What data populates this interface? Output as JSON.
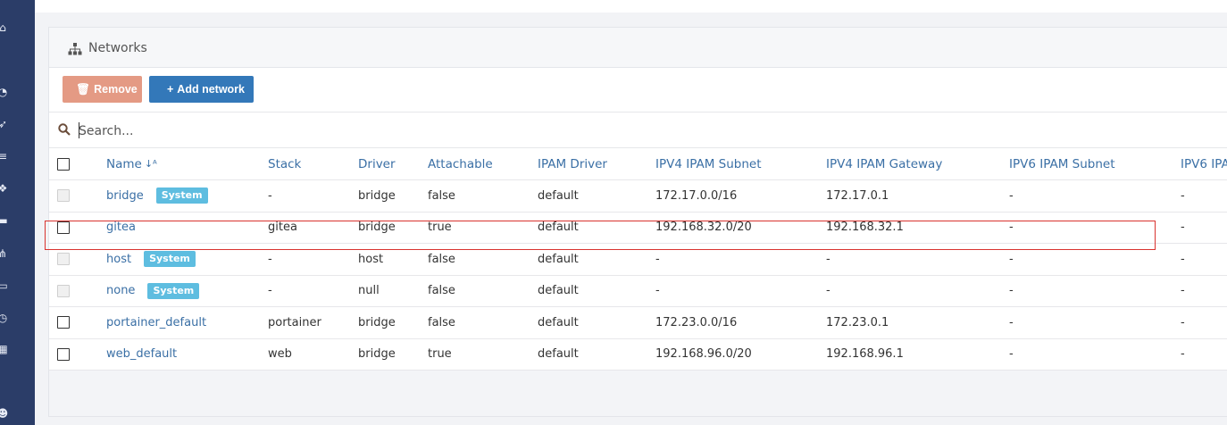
{
  "sidebar": {
    "icons": [
      "home-icon",
      "dashboard-icon",
      "rocket-icon",
      "server-icon",
      "cubes-icon",
      "monitor-icon",
      "network-icon",
      "hdd-icon",
      "clock-icon",
      "grid-icon",
      "users-icon"
    ]
  },
  "panel": {
    "title": "Networks",
    "title_icon": "sitemap-icon"
  },
  "toolbar": {
    "remove_label": "Remove",
    "add_label": "Add network"
  },
  "search": {
    "placeholder": "Search..."
  },
  "table": {
    "columns": [
      "Name",
      "Stack",
      "Driver",
      "Attachable",
      "IPAM Driver",
      "IPV4 IPAM Subnet",
      "IPV4 IPAM Gateway",
      "IPV6 IPAM Subnet",
      "IPV6 IPA"
    ],
    "rows": [
      {
        "name": "bridge",
        "badge": "System",
        "stack": "-",
        "driver": "bridge",
        "attachable": "false",
        "ipam": "default",
        "sub4": "172.17.0.0/16",
        "gw4": "172.17.0.1",
        "sub6": "-",
        "gw6": "-"
      },
      {
        "name": "gitea",
        "badge": "",
        "stack": "gitea",
        "driver": "bridge",
        "attachable": "true",
        "ipam": "default",
        "sub4": "192.168.32.0/20",
        "gw4": "192.168.32.1",
        "sub6": "-",
        "gw6": "-"
      },
      {
        "name": "host",
        "badge": "System",
        "stack": "-",
        "driver": "host",
        "attachable": "false",
        "ipam": "default",
        "sub4": "-",
        "gw4": "-",
        "sub6": "-",
        "gw6": "-"
      },
      {
        "name": "none",
        "badge": "System",
        "stack": "-",
        "driver": "null",
        "attachable": "false",
        "ipam": "default",
        "sub4": "-",
        "gw4": "-",
        "sub6": "-",
        "gw6": "-"
      },
      {
        "name": "portainer_default",
        "badge": "",
        "stack": "portainer",
        "driver": "bridge",
        "attachable": "false",
        "ipam": "default",
        "sub4": "172.23.0.0/16",
        "gw4": "172.23.0.1",
        "sub6": "-",
        "gw6": "-"
      },
      {
        "name": "web_default",
        "badge": "",
        "stack": "web",
        "driver": "bridge",
        "attachable": "true",
        "ipam": "default",
        "sub4": "192.168.96.0/20",
        "gw4": "192.168.96.1",
        "sub6": "-",
        "gw6": "-"
      }
    ]
  },
  "colors": {
    "sidebar": "#2b3d68",
    "remove_button": "#e49a84",
    "add_button": "#3378b9",
    "badge": "#5ebde0",
    "link": "#3a6fa5",
    "highlight": "#d9332f"
  }
}
